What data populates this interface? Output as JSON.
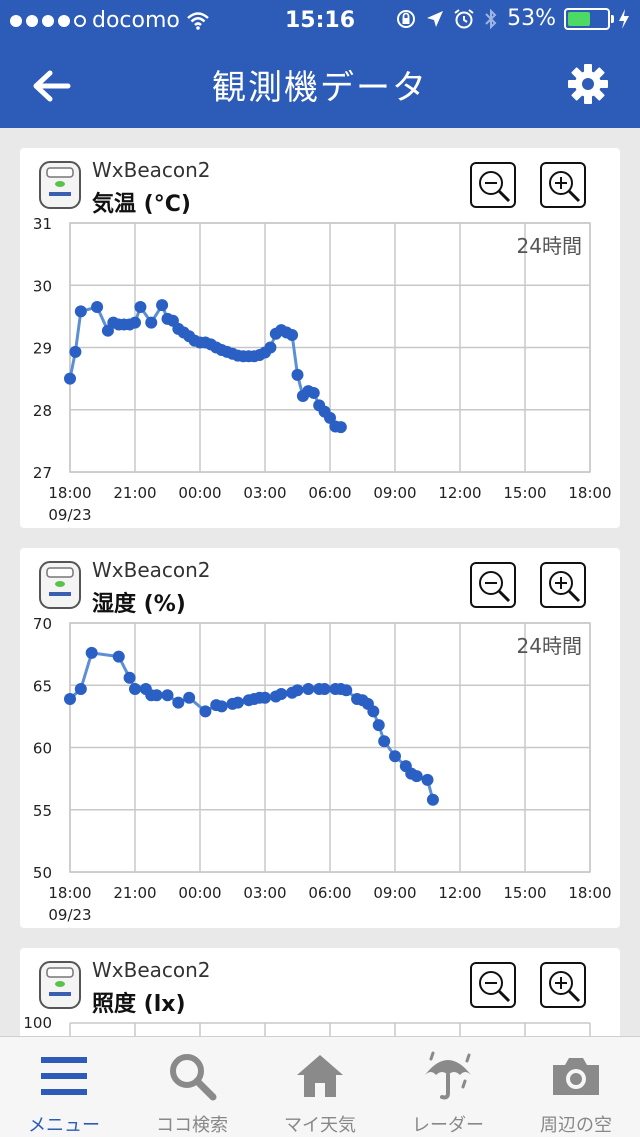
{
  "status_bar": {
    "carrier": "docomo",
    "time": "15:16",
    "battery_percent": "53%",
    "signal_dots_filled": 4
  },
  "header": {
    "title": "観測機データ"
  },
  "cards": [
    {
      "device": "WxBeacon2",
      "metric": "気温 (°C)",
      "range_badge": "24時間",
      "y_ticks": [
        "31",
        "30",
        "29",
        "28",
        "27"
      ],
      "x_ticks": [
        "18:00",
        "21:00",
        "00:00",
        "03:00",
        "06:00",
        "09:00",
        "12:00",
        "15:00",
        "18:00"
      ],
      "date_label": "09/23"
    },
    {
      "device": "WxBeacon2",
      "metric": "湿度 (%)",
      "range_badge": "24時間",
      "y_ticks": [
        "70",
        "65",
        "60",
        "55",
        "50"
      ],
      "x_ticks": [
        "18:00",
        "21:00",
        "00:00",
        "03:00",
        "06:00",
        "09:00",
        "12:00",
        "15:00",
        "18:00"
      ],
      "date_label": "09/23"
    },
    {
      "device": "WxBeacon2",
      "metric": "照度 (lx)",
      "range_badge": "",
      "y_ticks": [
        "100"
      ],
      "x_ticks": [],
      "date_label": ""
    }
  ],
  "chart_data": [
    {
      "type": "line",
      "title": "気温 (°C)",
      "xlabel": "",
      "ylabel": "",
      "ylim": [
        27,
        31
      ],
      "x": [
        0,
        0.25,
        0.5,
        1.25,
        1.75,
        2.0,
        2.25,
        2.5,
        2.75,
        3.0,
        3.25,
        3.75,
        4.25,
        4.5,
        4.75,
        5.0,
        5.25,
        5.5,
        5.75,
        6.0,
        6.25,
        6.5,
        6.75,
        7.0,
        7.25,
        7.5,
        7.75,
        8.0,
        8.25,
        8.5,
        8.75,
        9.0,
        9.25,
        9.5,
        9.75,
        10.0,
        10.25,
        10.5,
        10.75,
        11.0,
        11.25,
        11.5,
        11.75,
        12.0,
        12.25,
        12.5,
        12.75,
        13.0,
        13.25,
        13.5,
        13.75,
        14.0,
        14.25,
        14.5,
        14.75,
        15.0,
        15.25,
        15.5,
        15.75,
        16.0,
        16.25,
        16.5,
        16.75,
        17.0,
        17.25,
        17.5,
        17.75,
        18.0,
        18.25,
        18.5,
        18.75,
        19.0,
        19.25,
        19.5,
        19.75,
        20.0,
        20.25,
        20.5,
        20.75,
        21.0,
        21.25
      ],
      "y": [
        28.5,
        28.93,
        29.58,
        29.65,
        29.27,
        29.4,
        29.37,
        29.37,
        29.37,
        29.4,
        29.65,
        29.4,
        29.68,
        29.46,
        29.43,
        29.3,
        29.24,
        29.18,
        29.11,
        29.08,
        29.08,
        29.05,
        29.0,
        28.96,
        28.93,
        28.9,
        28.87,
        28.86,
        28.86,
        28.86,
        28.88,
        28.92,
        29.0,
        29.22,
        29.28,
        29.24,
        29.2,
        28.56,
        28.22,
        28.3,
        28.27,
        28.07,
        27.97,
        27.87,
        27.73,
        27.72,
        27.87,
        27.87,
        27.87,
        27.87,
        27.87,
        27.87,
        27.87,
        27.87,
        27.87,
        27.87,
        27.87,
        27.87,
        27.87,
        27.87,
        27.87,
        27.87,
        27.87,
        27.87,
        27.87,
        27.87,
        27.87,
        27.87,
        27.87,
        27.87,
        27.87,
        27.87,
        27.87,
        27.87,
        27.87,
        27.87,
        27.87,
        27.87,
        27.87,
        27.87,
        27.87
      ]
    },
    {
      "type": "line",
      "title": "湿度 (%)",
      "xlabel": "",
      "ylabel": "",
      "ylim": [
        50,
        70
      ],
      "x": [],
      "y": []
    }
  ],
  "tabs": [
    {
      "label": "メニュー",
      "icon": "menu-icon",
      "active": true
    },
    {
      "label": "ココ検索",
      "icon": "search-icon",
      "active": false
    },
    {
      "label": "マイ天気",
      "icon": "home-icon",
      "active": false
    },
    {
      "label": "レーダー",
      "icon": "umbrella-icon",
      "active": false
    },
    {
      "label": "周辺の空",
      "icon": "camera-icon",
      "active": false
    }
  ],
  "colors": {
    "brand": "#2c5bb8",
    "line": "#5b8fd6",
    "point": "#2a5fc4",
    "grid": "#c8c8c8",
    "tab_inactive": "#888888"
  }
}
